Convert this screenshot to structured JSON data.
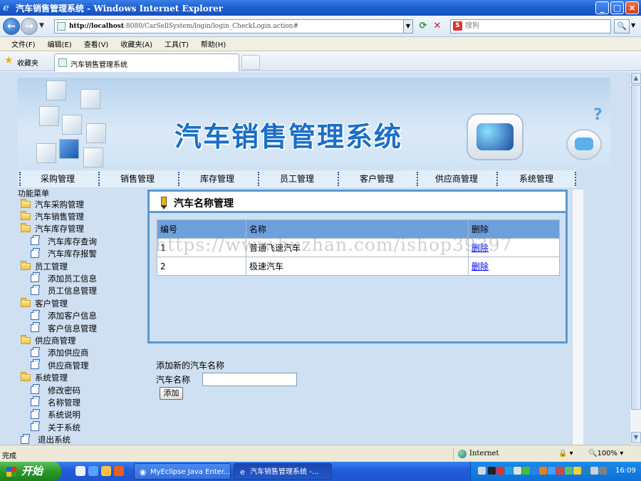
{
  "window": {
    "title": "汽车销售管理系统 - Windows Internet Explorer",
    "minimize": "_",
    "maximize": "□",
    "close": "×"
  },
  "address": {
    "url_host": "http://localhost",
    "url_rest": ":8080/CarSellSystem/login/login_CheckLogin.action#",
    "search_placeholder": "搜狗",
    "search_logo": "S",
    "go_glyph": "🔍"
  },
  "menu": [
    "文件(F)",
    "编辑(E)",
    "查看(V)",
    "收藏夹(A)",
    "工具(T)",
    "帮助(H)"
  ],
  "favorites": {
    "label": "收藏夹",
    "tab_title": "汽车销售管理系统"
  },
  "page": {
    "banner_title": "汽车销售管理系统",
    "nav": [
      "采购管理",
      "销售管理",
      "库存管理",
      "员工管理",
      "客户管理",
      "供应商管理",
      "系统管理"
    ],
    "side_menu_title": "功能菜单",
    "tree": [
      {
        "label": "汽车采购管理",
        "level": 0,
        "icon": "folder-icon"
      },
      {
        "label": "汽车销售管理",
        "level": 0,
        "icon": "folder-icon"
      },
      {
        "label": "汽车库存管理",
        "level": 0,
        "icon": "folder-open-icon"
      },
      {
        "label": "汽车库存查询",
        "level": 1,
        "icon": "page-icon"
      },
      {
        "label": "汽车库存报警",
        "level": 1,
        "icon": "page-icon"
      },
      {
        "label": "员工管理",
        "level": 0,
        "icon": "folder-open-icon"
      },
      {
        "label": "添加员工信息",
        "level": 1,
        "icon": "page-icon"
      },
      {
        "label": "员工信息管理",
        "level": 1,
        "icon": "page-icon"
      },
      {
        "label": "客户管理",
        "level": 0,
        "icon": "folder-open-icon"
      },
      {
        "label": "添加客户信息",
        "level": 1,
        "icon": "page-icon"
      },
      {
        "label": "客户信息管理",
        "level": 1,
        "icon": "page-icon"
      },
      {
        "label": "供应商管理",
        "level": 0,
        "icon": "folder-open-icon"
      },
      {
        "label": "添加供应商",
        "level": 1,
        "icon": "page-icon"
      },
      {
        "label": "供应商管理",
        "level": 1,
        "icon": "page-icon"
      },
      {
        "label": "系统管理",
        "level": 0,
        "icon": "folder-open-icon"
      },
      {
        "label": "修改密码",
        "level": 1,
        "icon": "page-icon"
      },
      {
        "label": "名称管理",
        "level": 1,
        "icon": "page-icon"
      },
      {
        "label": "系统说明",
        "level": 1,
        "icon": "page-icon"
      },
      {
        "label": "关于系统",
        "level": 1,
        "icon": "page-icon"
      },
      {
        "label": "退出系统",
        "level": 0,
        "icon": "page-icon"
      }
    ],
    "panel": {
      "title": "汽车名称管理",
      "columns": [
        "编号",
        "名称",
        "删除"
      ],
      "rows": [
        {
          "id": "1",
          "name": "普通飞速汽车",
          "action": "删除"
        },
        {
          "id": "2",
          "name": "极速汽车",
          "action": "删除"
        }
      ],
      "add_title": "添加新的汽车名称",
      "field_label": "汽车名称",
      "field_value": "",
      "add_button": "添加"
    },
    "watermark": "https://www.huzhan.com/ishop39397"
  },
  "status": {
    "text": "完成",
    "zone": "Internet",
    "protected": "🔒 ▾",
    "zoom": "🔍100%  ▾"
  },
  "taskbar": {
    "start": "开始",
    "buttons": [
      {
        "label": "MyEclipse Java Enter...",
        "active": false
      },
      {
        "label": "汽车销售管理系统 -...",
        "active": true
      }
    ],
    "clock": "16:09"
  },
  "colors": {
    "accent": "#1a6fc8",
    "panel_border": "#5a9ad0",
    "table_header": "#6ea0dc",
    "page_bg": "#cfe0f2"
  }
}
